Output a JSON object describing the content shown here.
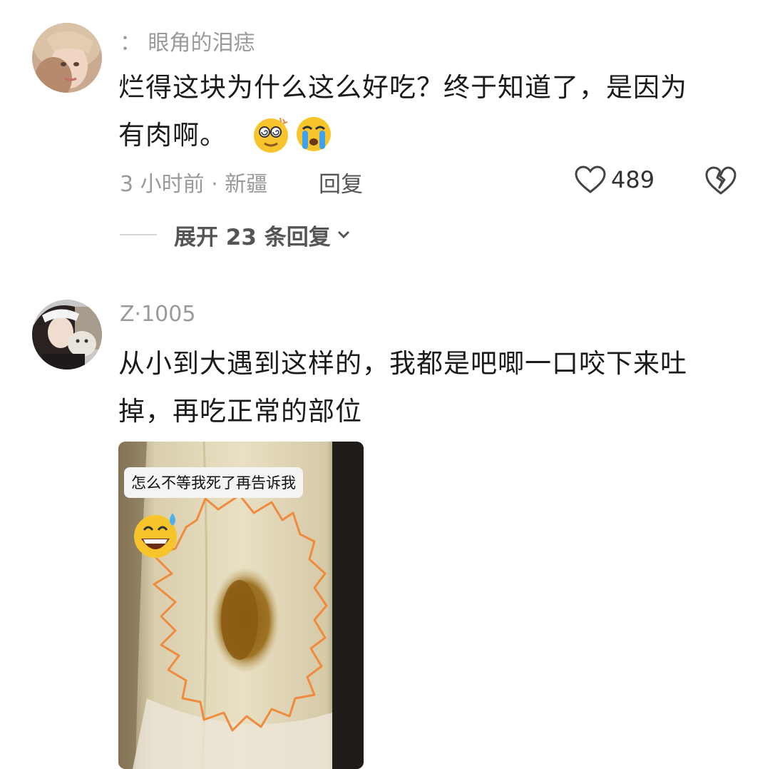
{
  "comments": [
    {
      "username": "： 眼角的泪痣",
      "content_line1": "烂得这块为什么这么好吃？终于知道了，是因为",
      "content_line2": "有肉啊。",
      "emoji_icons": [
        "dizzy-face-emoji",
        "crying-face-emoji"
      ],
      "meta": "3 小时前 · 新疆",
      "reply_label": "回复",
      "like_count": "489",
      "expand_label": "展开 23 条回复"
    },
    {
      "username": "Z·1005",
      "content_line1": "从小到大遇到这样的，我都是吧唧一口咬下来吐",
      "content_line2": "掉，再吃正常的部位",
      "image": {
        "caption": "怎么不等我死了再告诉我",
        "sticker_icon": "grinning-sweat-emoji"
      }
    }
  ],
  "colors": {
    "text": "#1b1b1b",
    "muted": "#9a9a9a",
    "emoji_yellow": "#f7c52b",
    "outline_orange": "#f08a3c"
  }
}
